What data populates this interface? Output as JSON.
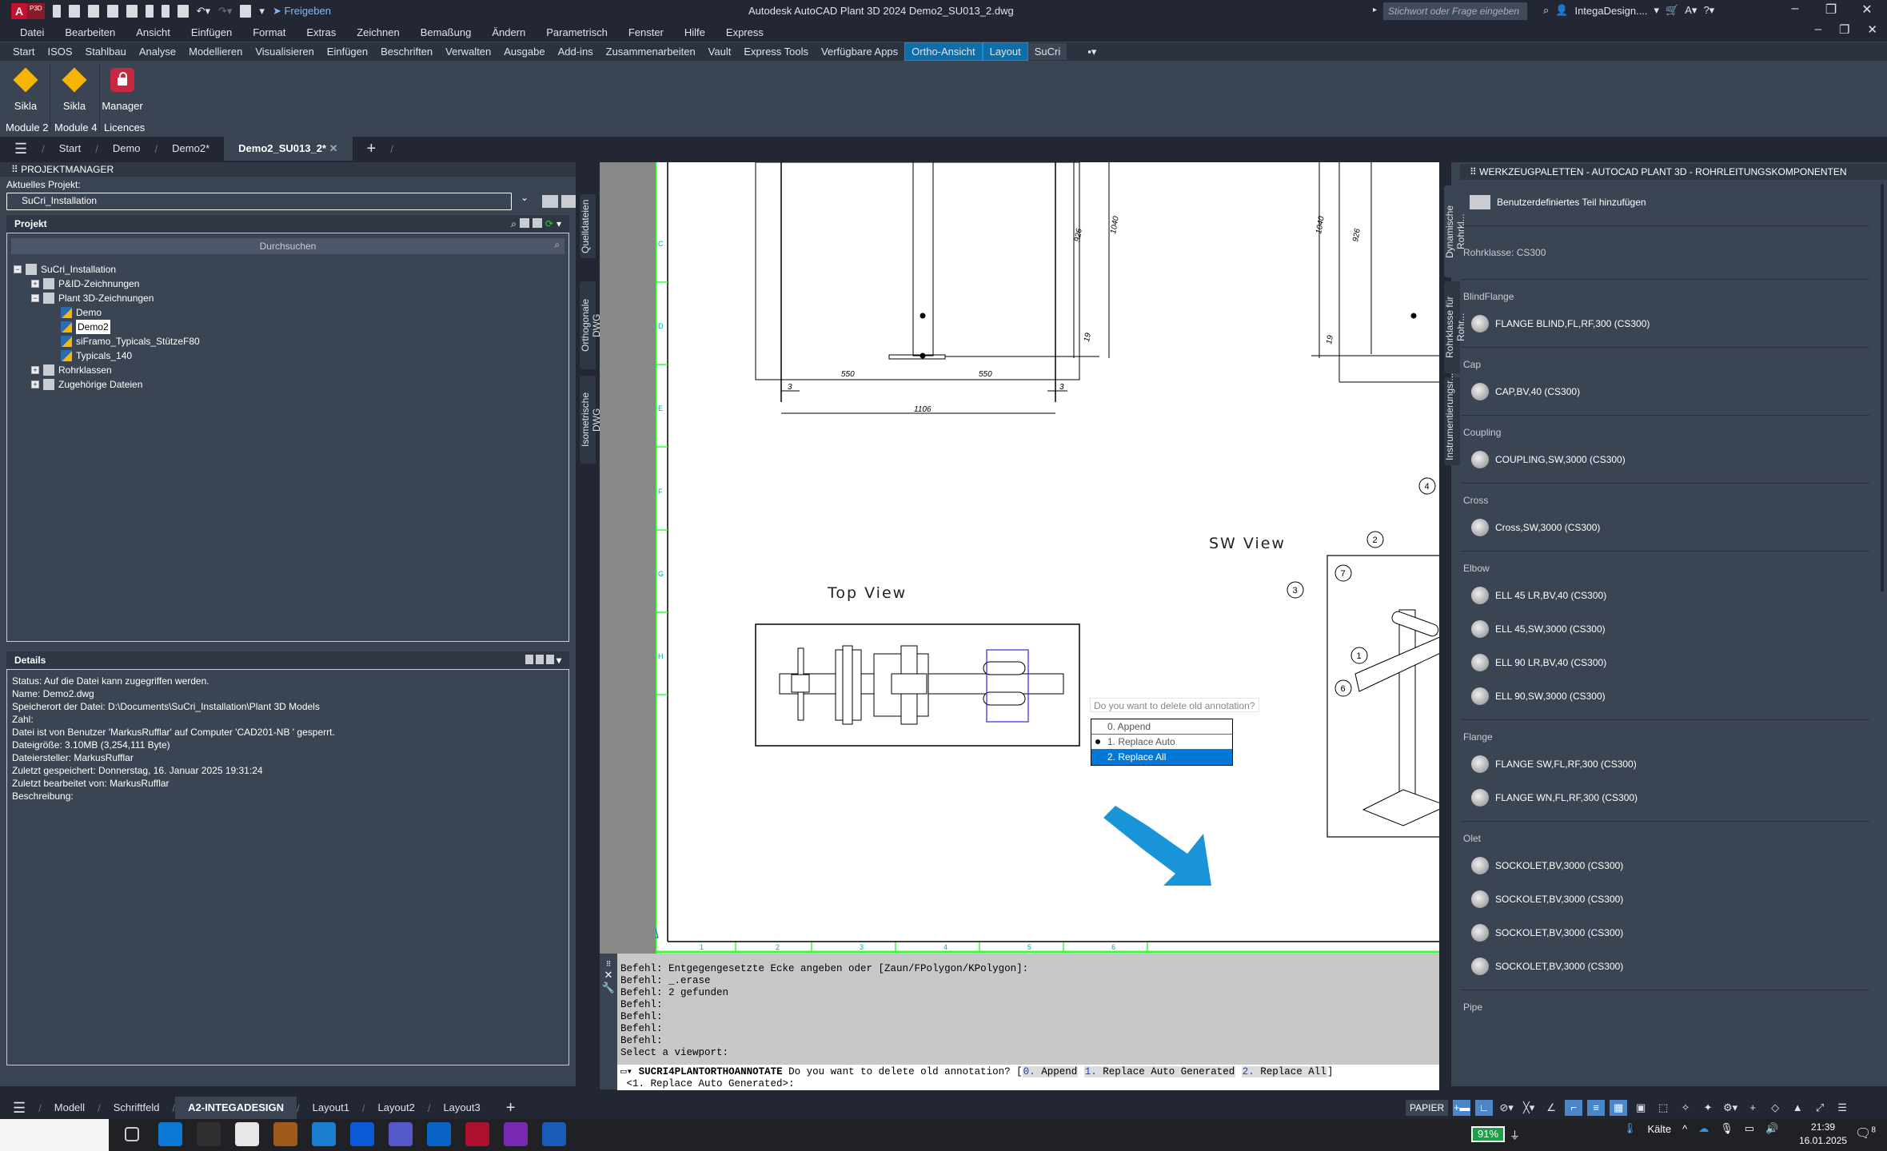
{
  "app": {
    "title": "Autodesk AutoCAD Plant 3D 2024   Demo2_SU013_2.dwg",
    "logo_badge": "P3D",
    "share_label": "Freigeben",
    "search_placeholder": "Stichwort oder Frage eingeben",
    "user": "IntegaDesign...."
  },
  "menubar": [
    "Datei",
    "Bearbeiten",
    "Ansicht",
    "Einfügen",
    "Format",
    "Extras",
    "Zeichnen",
    "Bemaßung",
    "Ändern",
    "Parametrisch",
    "Fenster",
    "Hilfe",
    "Express"
  ],
  "ribbon_tabs": [
    {
      "label": "Start"
    },
    {
      "label": "ISOS"
    },
    {
      "label": "Stahlbau"
    },
    {
      "label": "Analyse"
    },
    {
      "label": "Modellieren"
    },
    {
      "label": "Visualisieren"
    },
    {
      "label": "Einfügen"
    },
    {
      "label": "Beschriften"
    },
    {
      "label": "Verwalten"
    },
    {
      "label": "Ausgabe"
    },
    {
      "label": "Add-ins"
    },
    {
      "label": "Zusammenarbeiten"
    },
    {
      "label": "Vault"
    },
    {
      "label": "Express Tools"
    },
    {
      "label": "Verfügbare Apps"
    },
    {
      "label": "Ortho-Ansicht",
      "state": "highlight"
    },
    {
      "label": "Layout",
      "state": "highlight"
    },
    {
      "label": "SuCri",
      "state": "selected"
    }
  ],
  "ribbon": {
    "buttons": [
      {
        "label": "Sikla",
        "icon": "diamond-icon",
        "group": "Module 2"
      },
      {
        "label": "Sikla",
        "icon": "diamond-icon",
        "group": "Module 4"
      },
      {
        "label": "Manager",
        "icon": "lock-icon",
        "group": "Licences"
      }
    ]
  },
  "doc_tabs": [
    {
      "label": "Start"
    },
    {
      "label": "Demo"
    },
    {
      "label": "Demo2*"
    },
    {
      "label": "Demo2_SU013_2*",
      "active": true
    }
  ],
  "project_manager": {
    "title": "PROJEKTMANAGER",
    "current_project_label": "Aktuelles Projekt:",
    "current_project": "SuCri_Installation",
    "project_header": "Projekt",
    "search_label": "Durchsuchen",
    "tree": [
      {
        "label": "SuCri_Installation",
        "level": 0,
        "toggle": "−",
        "icon": "project-icon"
      },
      {
        "label": "P&ID-Zeichnungen",
        "level": 1,
        "toggle": "+",
        "icon": "pid-folder-icon"
      },
      {
        "label": "Plant 3D-Zeichnungen",
        "level": 1,
        "toggle": "−",
        "icon": "plant3d-folder-icon"
      },
      {
        "label": "Demo",
        "level": 2,
        "icon": "dwg-icon"
      },
      {
        "label": "Demo2",
        "level": 2,
        "icon": "dwg-locked-icon",
        "selected": true
      },
      {
        "label": "siFramo_Typicals_StützeF80",
        "level": 2,
        "icon": "dwg-icon"
      },
      {
        "label": "Typicals_140",
        "level": 2,
        "icon": "dwg-icon"
      },
      {
        "label": "Rohrklassen",
        "level": 1,
        "toggle": "+",
        "icon": "spec-icon"
      },
      {
        "label": "Zugehörige Dateien",
        "level": 1,
        "toggle": "+",
        "icon": "folder-icon"
      }
    ],
    "details_header": "Details",
    "details": [
      "Status: Auf die Datei kann zugegriffen werden.",
      "Name:  Demo2.dwg",
      "Speicherort der Datei: D:\\Documents\\SuCri_Installation\\Plant 3D Models",
      "Zahl:",
      "Datei ist von Benutzer 'MarkusRufflar' auf Computer 'CAD201-NB ' gesperrt.",
      "Dateigröße: 3.10MB (3,254,111 Byte)",
      "Dateiersteller:  MarkusRufflar",
      "Zuletzt gespeichert: Donnerstag, 16. Januar 2025 19:31:24",
      "Zuletzt bearbeitet von:  MarkusRufflar",
      "Beschreibung:"
    ]
  },
  "side_tabs": [
    "Quelldateien",
    "Orthogonale DWG",
    "Isometrische DWG"
  ],
  "drawing": {
    "row_labels": [
      "C",
      "D",
      "E",
      "F",
      "G",
      "H"
    ],
    "col_labels": [
      "1",
      "2",
      "3",
      "4",
      "5",
      "6"
    ],
    "dims": [
      "550",
      "550",
      "3",
      "3",
      "1106",
      "926",
      "1040",
      "19"
    ],
    "top_view_label": "Top View",
    "sw_view_label": "SW View",
    "balloons": [
      "4",
      "2",
      "7",
      "3",
      "1",
      "6"
    ]
  },
  "popup": {
    "question": "Do you want to delete old annotation?",
    "options": [
      {
        "label": "0. Append"
      },
      {
        "label": "1. Replace Auto Generated",
        "default": true
      },
      {
        "label": "2. Replace All",
        "highlighted": true
      }
    ]
  },
  "command_line": {
    "history": [
      "Befehl: Entgegengesetzte Ecke angeben oder [Zaun/FPolygon/KPolygon]:",
      "Befehl: _.erase",
      "Befehl: 2 gefunden",
      "Befehl:",
      "Befehl:",
      "Befehl:",
      "Befehl:",
      "Select a viewport:"
    ],
    "command": "SUCRI4PLANTORTHOANNOTATE",
    "prompt": "Do you want to delete old annotation? [",
    "options": [
      {
        "num": "0.",
        "text": " Append"
      },
      {
        "num": "1.",
        "text": " Replace Auto Generated"
      },
      {
        "num": "2.",
        "text": " Replace All"
      }
    ],
    "prompt_end": "]",
    "default_line": "<1. Replace Auto Generated>:"
  },
  "layout_tabs": [
    {
      "label": "Modell"
    },
    {
      "label": "Schriftfeld"
    },
    {
      "label": "A2-INTEGADESIGN",
      "active": true
    },
    {
      "label": "Layout1"
    },
    {
      "label": "Layout2"
    },
    {
      "label": "Layout3"
    }
  ],
  "statusbar": {
    "space": "PAPIER"
  },
  "palette": {
    "title": "WERKZEUGPALETTEN - AUTOCAD PLANT 3D - ROHRLEITUNGSKOMPONENTEN",
    "tabs": [
      "Dynamische Rohrkl...",
      "Rohrklasse für Rohr...",
      "Instrumentierungsr..."
    ],
    "add_custom": "Benutzerdefiniertes Teil hinzufügen",
    "spec": "Rohrklasse: CS300",
    "sections": [
      {
        "name": "BlindFlange",
        "items": [
          "FLANGE BLIND,FL,RF,300 (CS300)"
        ]
      },
      {
        "name": "Cap",
        "items": [
          "CAP,BV,40 (CS300)"
        ]
      },
      {
        "name": "Coupling",
        "items": [
          "COUPLING,SW,3000 (CS300)"
        ]
      },
      {
        "name": "Cross",
        "items": [
          "Cross,SW,3000 (CS300)"
        ]
      },
      {
        "name": "Elbow",
        "items": [
          "ELL 45 LR,BV,40 (CS300)",
          "ELL 45,SW,3000 (CS300)",
          "ELL 90 LR,BV,40 (CS300)",
          "ELL 90,SW,3000 (CS300)"
        ]
      },
      {
        "name": "Flange",
        "items": [
          "FLANGE SW,FL,RF,300 (CS300)",
          "FLANGE WN,FL,RF,300 (CS300)"
        ]
      },
      {
        "name": "Olet",
        "items": [
          "SOCKOLET,BV,3000 (CS300)",
          "SOCKOLET,BV,3000 (CS300)",
          "SOCKOLET,BV,3000 (CS300)",
          "SOCKOLET,BV,3000 (CS300)"
        ]
      },
      {
        "name": "Pipe",
        "items": []
      }
    ]
  },
  "taskbar": {
    "apps": [
      "task-view",
      "company-portal",
      "terminal-app",
      "chrome",
      "file-explorer",
      "edge",
      "m-app",
      "teams",
      "outlook",
      "autocad-plant3d",
      "onenote",
      "word"
    ],
    "battery": "91%",
    "weather": "Kälte",
    "time": "21:39",
    "date": "16.01.2025",
    "notifications": "8"
  }
}
